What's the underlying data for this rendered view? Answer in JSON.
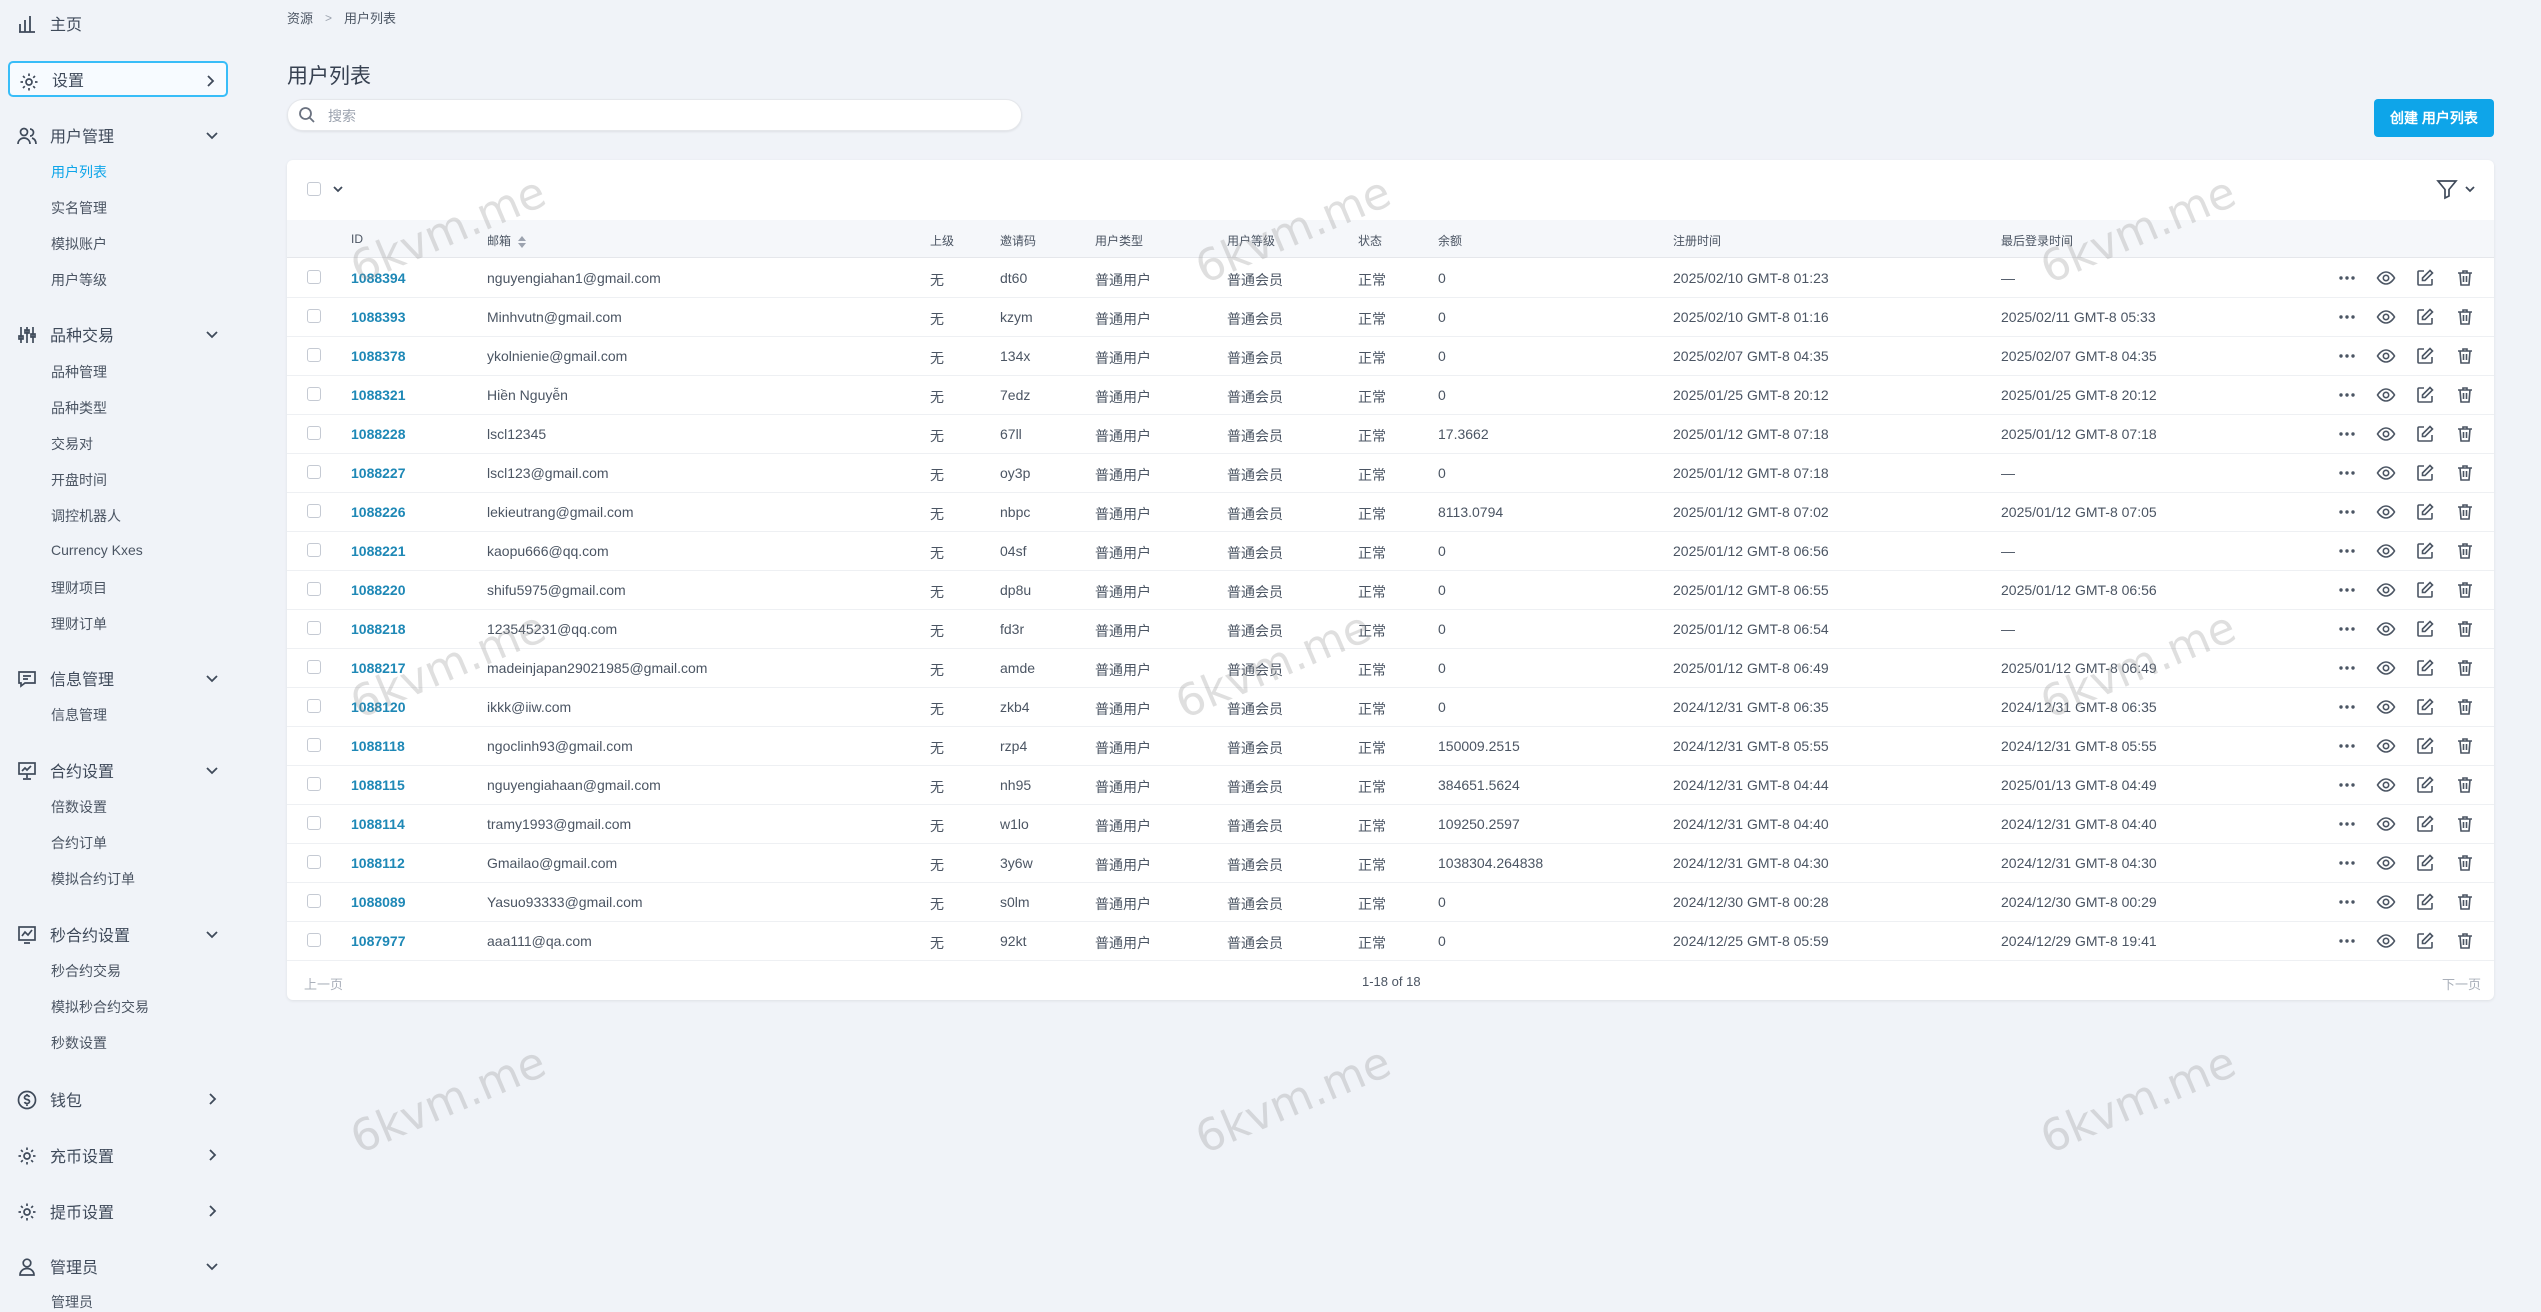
{
  "sidebar": {
    "home": "主页",
    "settings": "设置",
    "user_mgmt": {
      "label": "用户管理",
      "items": [
        "用户列表",
        "实名管理",
        "模拟账户",
        "用户等级"
      ]
    },
    "trading": {
      "label": "品种交易",
      "items": [
        "品种管理",
        "品种类型",
        "交易对",
        "开盘时间",
        "调控机器人",
        "Currency Kxes",
        "理财项目",
        "理财订单"
      ]
    },
    "info": {
      "label": "信息管理",
      "items": [
        "信息管理"
      ]
    },
    "contract": {
      "label": "合约设置",
      "items": [
        "倍数设置",
        "合约订单",
        "模拟合约订单"
      ]
    },
    "seconds": {
      "label": "秒合约设置",
      "items": [
        "秒合约交易",
        "模拟秒合约交易",
        "秒数设置"
      ]
    },
    "wallet": "钱包",
    "deposit": "充币设置",
    "withdraw": "提币设置",
    "admin": {
      "label": "管理员",
      "items": [
        "管理员"
      ]
    }
  },
  "breadcrumb": {
    "root": "资源",
    "current": "用户列表"
  },
  "page_title": "用户列表",
  "search": {
    "placeholder": "搜索",
    "value": ""
  },
  "create_button": "创建 用户列表",
  "table": {
    "headers": {
      "id": "ID",
      "email": "邮箱",
      "parent": "上级",
      "invite": "邀请码",
      "user_type": "用户类型",
      "user_level": "用户等级",
      "status": "状态",
      "balance": "余额",
      "registered": "注册时间",
      "last_login": "最后登录时间"
    },
    "rows": [
      {
        "id": "1088394",
        "email": "nguyengiahan1@gmail.com",
        "parent": "无",
        "invite": "dt60",
        "type": "普通用户",
        "level": "普通会员",
        "status": "正常",
        "balance": "0",
        "registered": "2025/02/10 GMT-8 01:23",
        "last_login": "—"
      },
      {
        "id": "1088393",
        "email": "Minhvutn@gmail.com",
        "parent": "无",
        "invite": "kzym",
        "type": "普通用户",
        "level": "普通会员",
        "status": "正常",
        "balance": "0",
        "registered": "2025/02/10 GMT-8 01:16",
        "last_login": "2025/02/11 GMT-8 05:33"
      },
      {
        "id": "1088378",
        "email": "ykolnienie@gmail.com",
        "parent": "无",
        "invite": "134x",
        "type": "普通用户",
        "level": "普通会员",
        "status": "正常",
        "balance": "0",
        "registered": "2025/02/07 GMT-8 04:35",
        "last_login": "2025/02/07 GMT-8 04:35"
      },
      {
        "id": "1088321",
        "email": "Hiền Nguyễn",
        "parent": "无",
        "invite": "7edz",
        "type": "普通用户",
        "level": "普通会员",
        "status": "正常",
        "balance": "0",
        "registered": "2025/01/25 GMT-8 20:12",
        "last_login": "2025/01/25 GMT-8 20:12"
      },
      {
        "id": "1088228",
        "email": "lscl12345",
        "parent": "无",
        "invite": "67ll",
        "type": "普通用户",
        "level": "普通会员",
        "status": "正常",
        "balance": "17.3662",
        "registered": "2025/01/12 GMT-8 07:18",
        "last_login": "2025/01/12 GMT-8 07:18"
      },
      {
        "id": "1088227",
        "email": "lscl123@gmail.com",
        "parent": "无",
        "invite": "oy3p",
        "type": "普通用户",
        "level": "普通会员",
        "status": "正常",
        "balance": "0",
        "registered": "2025/01/12 GMT-8 07:18",
        "last_login": "—"
      },
      {
        "id": "1088226",
        "email": "lekieutrang@gmail.com",
        "parent": "无",
        "invite": "nbpc",
        "type": "普通用户",
        "level": "普通会员",
        "status": "正常",
        "balance": "8113.0794",
        "registered": "2025/01/12 GMT-8 07:02",
        "last_login": "2025/01/12 GMT-8 07:05"
      },
      {
        "id": "1088221",
        "email": "kaopu666@qq.com",
        "parent": "无",
        "invite": "04sf",
        "type": "普通用户",
        "level": "普通会员",
        "status": "正常",
        "balance": "0",
        "registered": "2025/01/12 GMT-8 06:56",
        "last_login": "—"
      },
      {
        "id": "1088220",
        "email": "shifu5975@gmail.com",
        "parent": "无",
        "invite": "dp8u",
        "type": "普通用户",
        "level": "普通会员",
        "status": "正常",
        "balance": "0",
        "registered": "2025/01/12 GMT-8 06:55",
        "last_login": "2025/01/12 GMT-8 06:56"
      },
      {
        "id": "1088218",
        "email": "123545231@qq.com",
        "parent": "无",
        "invite": "fd3r",
        "type": "普通用户",
        "level": "普通会员",
        "status": "正常",
        "balance": "0",
        "registered": "2025/01/12 GMT-8 06:54",
        "last_login": "—"
      },
      {
        "id": "1088217",
        "email": "madeinjapan29021985@gmail.com",
        "parent": "无",
        "invite": "amde",
        "type": "普通用户",
        "level": "普通会员",
        "status": "正常",
        "balance": "0",
        "registered": "2025/01/12 GMT-8 06:49",
        "last_login": "2025/01/12 GMT-8 06:49"
      },
      {
        "id": "1088120",
        "email": "ikkk@iiw.com",
        "parent": "无",
        "invite": "zkb4",
        "type": "普通用户",
        "level": "普通会员",
        "status": "正常",
        "balance": "0",
        "registered": "2024/12/31 GMT-8 06:35",
        "last_login": "2024/12/31 GMT-8 06:35"
      },
      {
        "id": "1088118",
        "email": "ngoclinh93@gmail.com",
        "parent": "无",
        "invite": "rzp4",
        "type": "普通用户",
        "level": "普通会员",
        "status": "正常",
        "balance": "150009.2515",
        "registered": "2024/12/31 GMT-8 05:55",
        "last_login": "2024/12/31 GMT-8 05:55"
      },
      {
        "id": "1088115",
        "email": "nguyengiahaan@gmail.com",
        "parent": "无",
        "invite": "nh95",
        "type": "普通用户",
        "level": "普通会员",
        "status": "正常",
        "balance": "384651.5624",
        "registered": "2024/12/31 GMT-8 04:44",
        "last_login": "2025/01/13 GMT-8 04:49"
      },
      {
        "id": "1088114",
        "email": "tramy1993@gmail.com",
        "parent": "无",
        "invite": "w1lo",
        "type": "普通用户",
        "level": "普通会员",
        "status": "正常",
        "balance": "109250.2597",
        "registered": "2024/12/31 GMT-8 04:40",
        "last_login": "2024/12/31 GMT-8 04:40"
      },
      {
        "id": "1088112",
        "email": "Gmailao@gmail.com",
        "parent": "无",
        "invite": "3y6w",
        "type": "普通用户",
        "level": "普通会员",
        "status": "正常",
        "balance": "1038304.264838",
        "registered": "2024/12/31 GMT-8 04:30",
        "last_login": "2024/12/31 GMT-8 04:30"
      },
      {
        "id": "1088089",
        "email": "Yasuo93333@gmail.com",
        "parent": "无",
        "invite": "s0lm",
        "type": "普通用户",
        "level": "普通会员",
        "status": "正常",
        "balance": "0",
        "registered": "2024/12/30 GMT-8 00:28",
        "last_login": "2024/12/30 GMT-8 00:29"
      },
      {
        "id": "1087977",
        "email": "aaa111@qa.com",
        "parent": "无",
        "invite": "92kt",
        "type": "普通用户",
        "level": "普通会员",
        "status": "正常",
        "balance": "0",
        "registered": "2024/12/25 GMT-8 05:59",
        "last_login": "2024/12/29 GMT-8 19:41"
      }
    ]
  },
  "pagination": {
    "prev": "上一页",
    "range": "1-18 of 18",
    "next": "下一页"
  },
  "watermark": "6kvm.me",
  "colors": {
    "accent": "#0ea5e9",
    "id_link": "#1e88b6",
    "background": "#f0f3f8"
  }
}
